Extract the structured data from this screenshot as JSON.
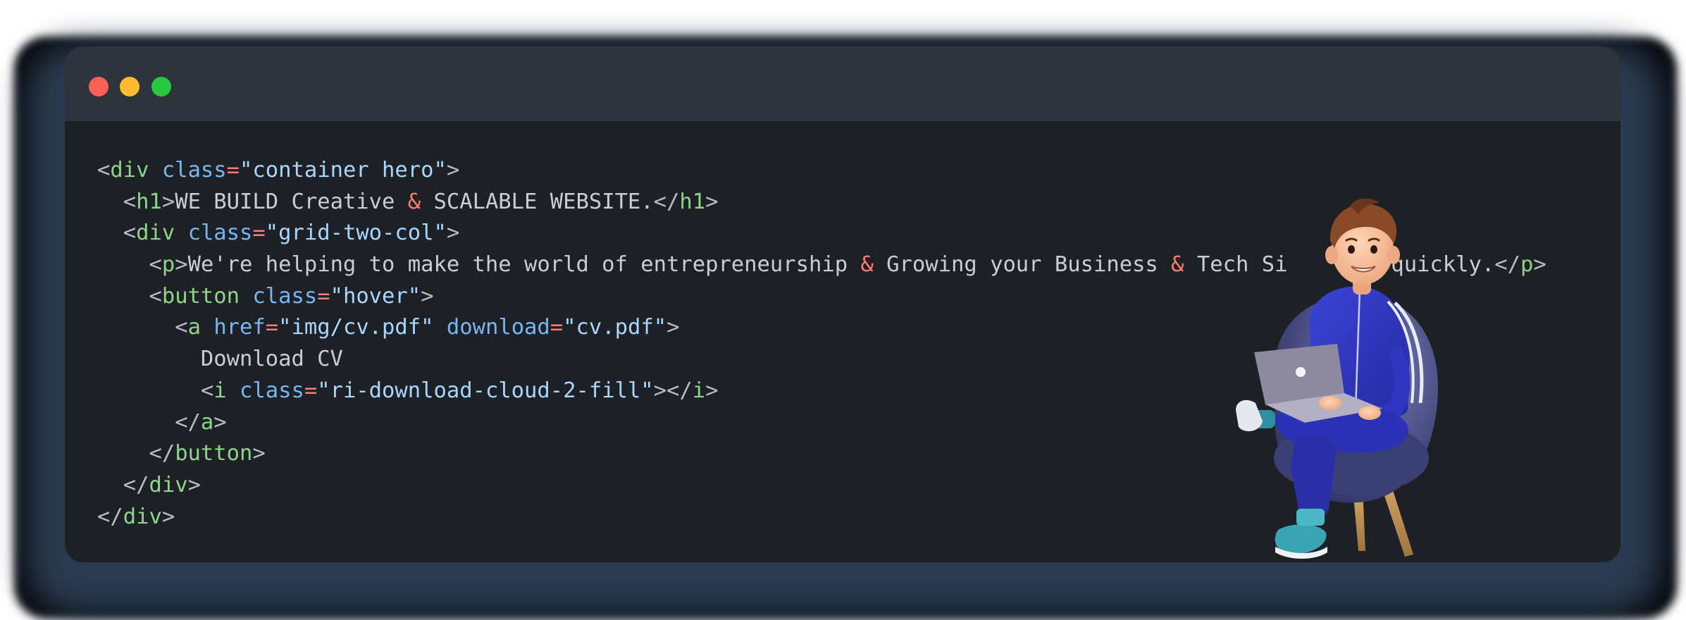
{
  "window": {
    "controls": [
      "close",
      "minimize",
      "maximize"
    ],
    "colors": {
      "background": "#1d2126",
      "titlebar": "#2e343c",
      "close": "#fe5f57",
      "minimize": "#febc2e",
      "maximize": "#28c840"
    }
  },
  "code": {
    "language": "html",
    "lines": [
      [
        {
          "t": "punct",
          "v": "<"
        },
        {
          "t": "tag",
          "v": "div"
        },
        {
          "t": "text",
          "v": " "
        },
        {
          "t": "attr",
          "v": "class"
        },
        {
          "t": "eq",
          "v": "="
        },
        {
          "t": "str",
          "v": "\"container hero\""
        },
        {
          "t": "punct",
          "v": ">"
        }
      ],
      [
        {
          "t": "text",
          "v": "  "
        },
        {
          "t": "punct",
          "v": "<"
        },
        {
          "t": "tag",
          "v": "h1"
        },
        {
          "t": "punct",
          "v": ">"
        },
        {
          "t": "text",
          "v": "WE BUILD Creative "
        },
        {
          "t": "amp",
          "v": "&"
        },
        {
          "t": "text",
          "v": " SCALABLE WEBSITE."
        },
        {
          "t": "punct",
          "v": "</"
        },
        {
          "t": "tag",
          "v": "h1"
        },
        {
          "t": "punct",
          "v": ">"
        }
      ],
      [
        {
          "t": "text",
          "v": "  "
        },
        {
          "t": "punct",
          "v": "<"
        },
        {
          "t": "tag",
          "v": "div"
        },
        {
          "t": "text",
          "v": " "
        },
        {
          "t": "attr",
          "v": "class"
        },
        {
          "t": "eq",
          "v": "="
        },
        {
          "t": "str",
          "v": "\"grid-two-col\""
        },
        {
          "t": "punct",
          "v": ">"
        }
      ],
      [
        {
          "t": "text",
          "v": "    "
        },
        {
          "t": "punct",
          "v": "<"
        },
        {
          "t": "tag",
          "v": "p"
        },
        {
          "t": "punct",
          "v": ">"
        },
        {
          "t": "text",
          "v": "We're helping to make the world of entrepreneurship "
        },
        {
          "t": "amp",
          "v": "&"
        },
        {
          "t": "text",
          "v": " Growing your Business "
        },
        {
          "t": "amp",
          "v": "&"
        },
        {
          "t": "text",
          "v": " Tech Si      s quickly."
        },
        {
          "t": "punct",
          "v": "</"
        },
        {
          "t": "tag",
          "v": "p"
        },
        {
          "t": "punct",
          "v": ">"
        }
      ],
      [
        {
          "t": "text",
          "v": "    "
        },
        {
          "t": "punct",
          "v": "<"
        },
        {
          "t": "tag",
          "v": "button"
        },
        {
          "t": "text",
          "v": " "
        },
        {
          "t": "attr",
          "v": "class"
        },
        {
          "t": "eq",
          "v": "="
        },
        {
          "t": "str",
          "v": "\"hover\""
        },
        {
          "t": "punct",
          "v": ">"
        }
      ],
      [
        {
          "t": "text",
          "v": "      "
        },
        {
          "t": "punct",
          "v": "<"
        },
        {
          "t": "tag",
          "v": "a"
        },
        {
          "t": "text",
          "v": " "
        },
        {
          "t": "attr",
          "v": "href"
        },
        {
          "t": "eq",
          "v": "="
        },
        {
          "t": "str",
          "v": "\"img/cv.pdf\""
        },
        {
          "t": "text",
          "v": " "
        },
        {
          "t": "attr",
          "v": "download"
        },
        {
          "t": "eq",
          "v": "="
        },
        {
          "t": "str",
          "v": "\"cv.pdf\""
        },
        {
          "t": "punct",
          "v": ">"
        }
      ],
      [
        {
          "t": "text",
          "v": "        Download CV"
        }
      ],
      [
        {
          "t": "text",
          "v": "        "
        },
        {
          "t": "punct",
          "v": "<"
        },
        {
          "t": "tag",
          "v": "i"
        },
        {
          "t": "text",
          "v": " "
        },
        {
          "t": "attr",
          "v": "class"
        },
        {
          "t": "eq",
          "v": "="
        },
        {
          "t": "str",
          "v": "\"ri-download-cloud-2-fill\""
        },
        {
          "t": "punct",
          "v": "></"
        },
        {
          "t": "tag",
          "v": "i"
        },
        {
          "t": "punct",
          "v": ">"
        }
      ],
      [
        {
          "t": "text",
          "v": "      "
        },
        {
          "t": "punct",
          "v": "</"
        },
        {
          "t": "tag",
          "v": "a"
        },
        {
          "t": "punct",
          "v": ">"
        }
      ],
      [
        {
          "t": "text",
          "v": "    "
        },
        {
          "t": "punct",
          "v": "</"
        },
        {
          "t": "tag",
          "v": "button"
        },
        {
          "t": "punct",
          "v": ">"
        }
      ],
      [
        {
          "t": "text",
          "v": "  "
        },
        {
          "t": "punct",
          "v": "</"
        },
        {
          "t": "tag",
          "v": "div"
        },
        {
          "t": "punct",
          "v": ">"
        }
      ],
      [
        {
          "t": "punct",
          "v": "</"
        },
        {
          "t": "tag",
          "v": "div"
        },
        {
          "t": "punct",
          "v": ">"
        }
      ]
    ]
  },
  "illustration": {
    "subject": "3d-character-with-laptop-in-armchair"
  }
}
